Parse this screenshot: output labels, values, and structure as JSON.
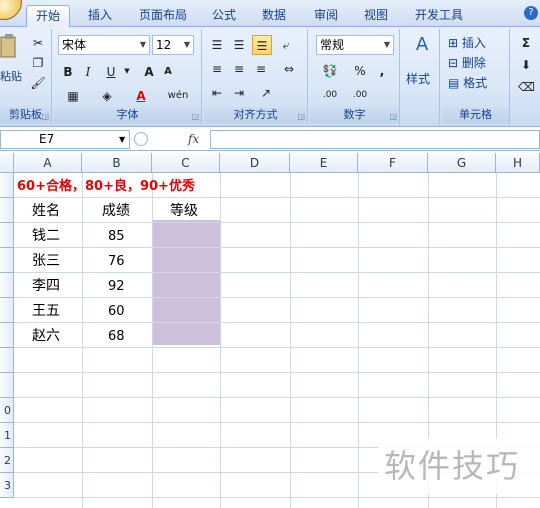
{
  "tabs": [
    "开始",
    "插入",
    "页面布局",
    "公式",
    "数据",
    "审阅",
    "视图",
    "开发工具"
  ],
  "ribbon": {
    "clipboard": {
      "paste_label": "粘贴",
      "group_label": "剪贴板"
    },
    "font": {
      "name": "宋体",
      "size": "12",
      "bold": "B",
      "italic": "I",
      "underline": "U",
      "grow": "A",
      "shrink": "A",
      "phonetic": "wén",
      "group_label": "字体"
    },
    "alignment": {
      "group_label": "对齐方式"
    },
    "number": {
      "format": "常规",
      "percent": "%",
      "comma": ",",
      "inc": ".00",
      "dec": ".00",
      "group_label": "数字"
    },
    "styles": {
      "label": "样式"
    },
    "cells": {
      "insert": "插入",
      "delete": "删除",
      "format": "格式",
      "group_label": "单元格"
    },
    "editing": {
      "sum": "Σ"
    }
  },
  "formula_bar": {
    "name_box": "E7",
    "fx": "fx",
    "value": ""
  },
  "columns": [
    "A",
    "B",
    "C",
    "D",
    "E",
    "F",
    "G",
    "H"
  ],
  "rows": [
    "",
    "",
    "",
    "",
    "",
    "",
    "",
    "",
    "",
    "0",
    "1",
    "2",
    "3"
  ],
  "sheet": {
    "note": "60+合格，80+良，90+优秀",
    "headers": [
      "姓名",
      "成绩",
      "等级"
    ],
    "records": [
      {
        "name": "钱二",
        "score": "85"
      },
      {
        "name": "张三",
        "score": "76"
      },
      {
        "name": "李四",
        "score": "92"
      },
      {
        "name": "王五",
        "score": "60"
      },
      {
        "name": "赵六",
        "score": "68"
      }
    ]
  },
  "colors": {
    "note_red": "#e60000",
    "grade_fill": "#ccc0da",
    "accent": "#15428b"
  },
  "watermark": "软件技巧"
}
